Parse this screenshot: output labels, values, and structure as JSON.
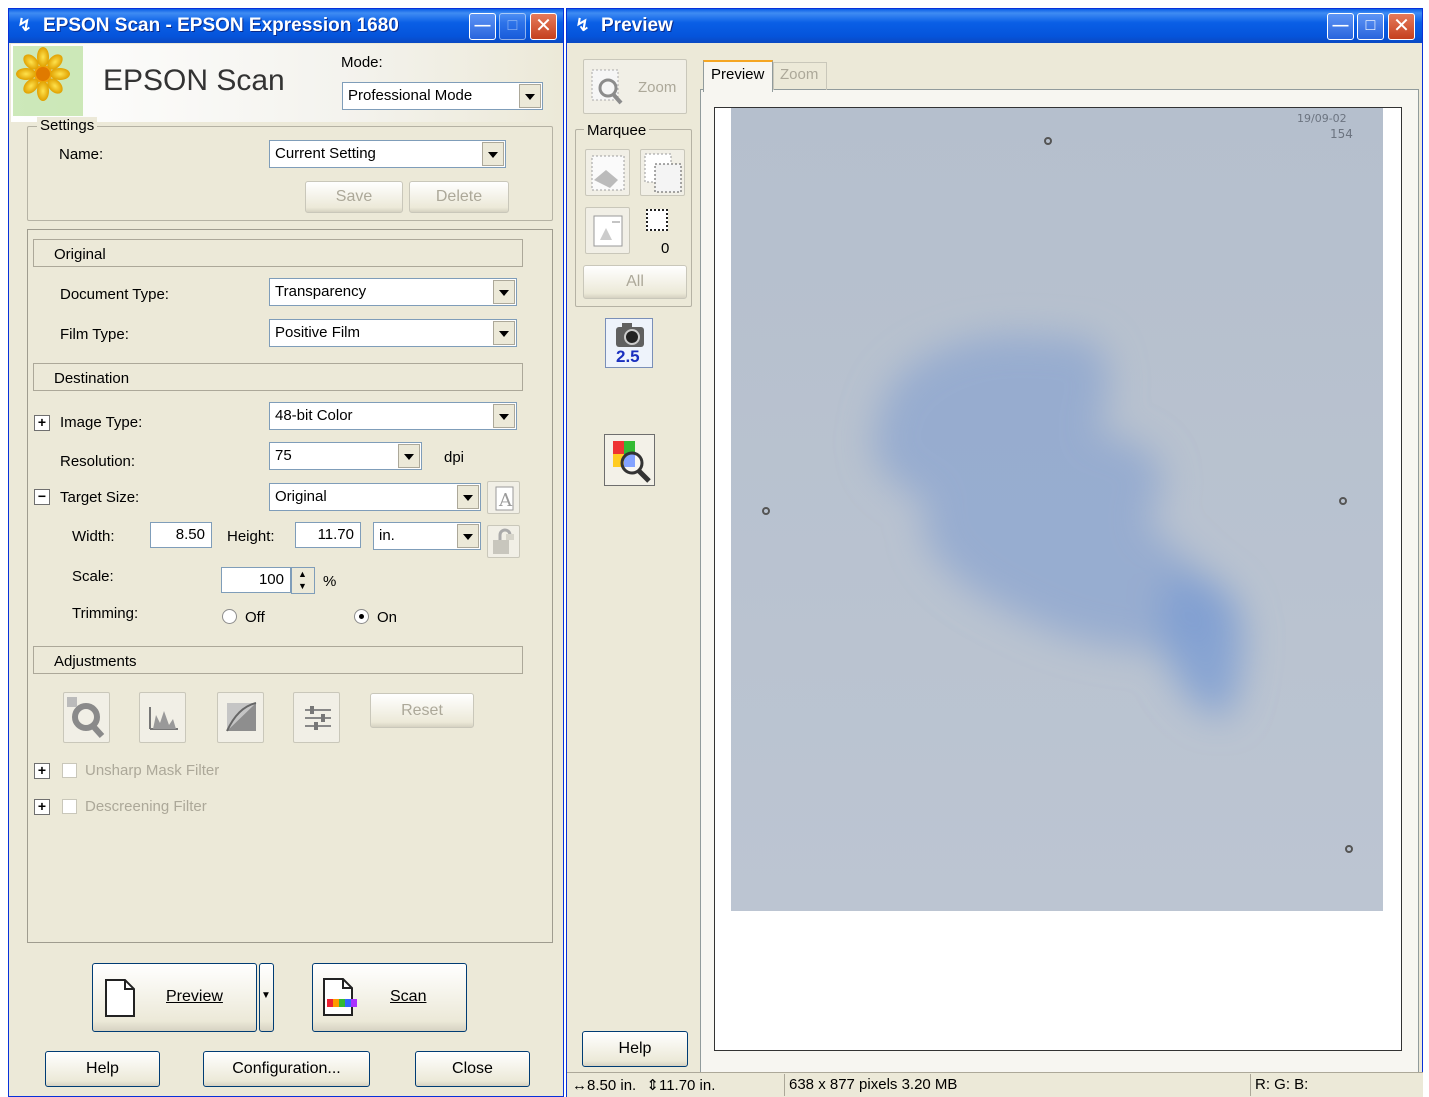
{
  "main_window": {
    "title": "EPSON Scan - EPSON Expression 1680",
    "brand": "EPSON Scan",
    "mode_label": "Mode:",
    "mode_value": "Professional Mode",
    "settings": {
      "group_label": "Settings",
      "name_label": "Name:",
      "name_value": "Current Setting",
      "save_label": "Save",
      "delete_label": "Delete"
    },
    "original": {
      "header": "Original",
      "document_type_label": "Document Type:",
      "document_type_value": "Transparency",
      "film_type_label": "Film Type:",
      "film_type_value": "Positive Film"
    },
    "destination": {
      "header": "Destination",
      "image_type_label": "Image Type:",
      "image_type_value": "48-bit Color",
      "resolution_label": "Resolution:",
      "resolution_value": "75",
      "resolution_unit": "dpi",
      "target_size_label": "Target Size:",
      "target_size_value": "Original",
      "width_label": "Width:",
      "width_value": "8.50",
      "height_label": "Height:",
      "height_value": "11.70",
      "unit_value": "in.",
      "scale_label": "Scale:",
      "scale_value": "100",
      "scale_unit": "%",
      "trimming_label": "Trimming:",
      "trimming_off": "Off",
      "trimming_on": "On"
    },
    "adjustments": {
      "header": "Adjustments",
      "reset_label": "Reset",
      "unsharp_label": "Unsharp Mask Filter",
      "descreening_label": "Descreening Filter"
    },
    "preview_button": "Preview",
    "scan_button": "Scan",
    "help_button": "Help",
    "configuration_button": "Configuration...",
    "close_button": "Close"
  },
  "preview_window": {
    "title": "Preview",
    "zoom_button": "Zoom",
    "marquee_label": "Marquee",
    "marquee_count": "0",
    "all_button": "All",
    "auto_exposure_value": "2.5",
    "help_button": "Help",
    "tabs": [
      "Preview",
      "Zoom"
    ],
    "scan_mark_line1": "19/09-02",
    "scan_mark_line2": "154"
  },
  "status_bar": {
    "width": "8.50 in.",
    "height": "11.70 in.",
    "pixels": "638 x 877 pixels 3.20 MB",
    "rgb": "R: G: B:"
  }
}
